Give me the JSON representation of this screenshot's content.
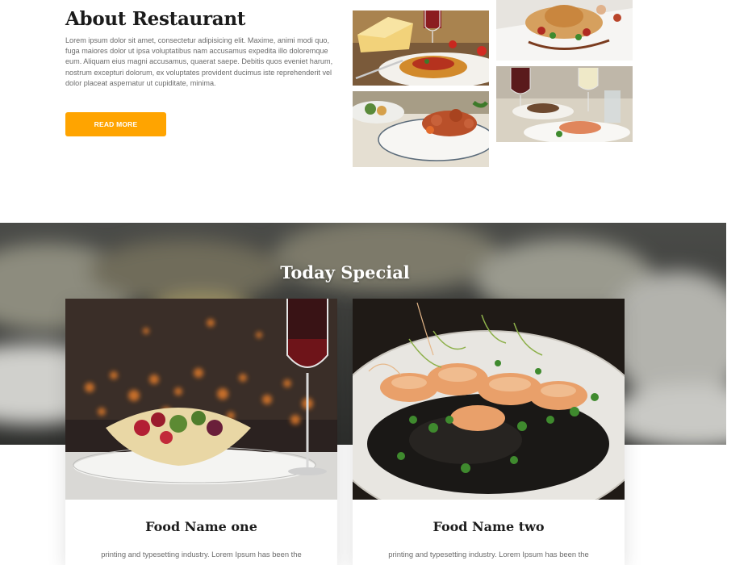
{
  "about": {
    "title": "About Restaurant",
    "body": "Lorem ipsum dolor sit amet, consectetur adipisicing elit. Maxime, animi modi quo, fuga maiores dolor ut ipsa voluptatibus nam accusamus expedita illo doloremque eum. Aliquam eius magni accusamus, quaerat saepe. Debitis quos eveniet harum, nostrum excepturi dolorum, ex voluptates provident ducimus iste reprehenderit vel dolor placeat aspernatur ut cupiditate, minima.",
    "button_label": "READ MORE"
  },
  "special": {
    "title": "Today Special",
    "cards": [
      {
        "name": "Food Name one",
        "description": "printing and typesetting industry. Lorem Ipsum has been the"
      },
      {
        "name": "Food Name two",
        "description": "printing and typesetting industry. Lorem Ipsum has been the"
      }
    ]
  },
  "colors": {
    "accent": "#ffa400",
    "title_text": "#1b1b1b",
    "body_text": "#6b6b6b"
  }
}
